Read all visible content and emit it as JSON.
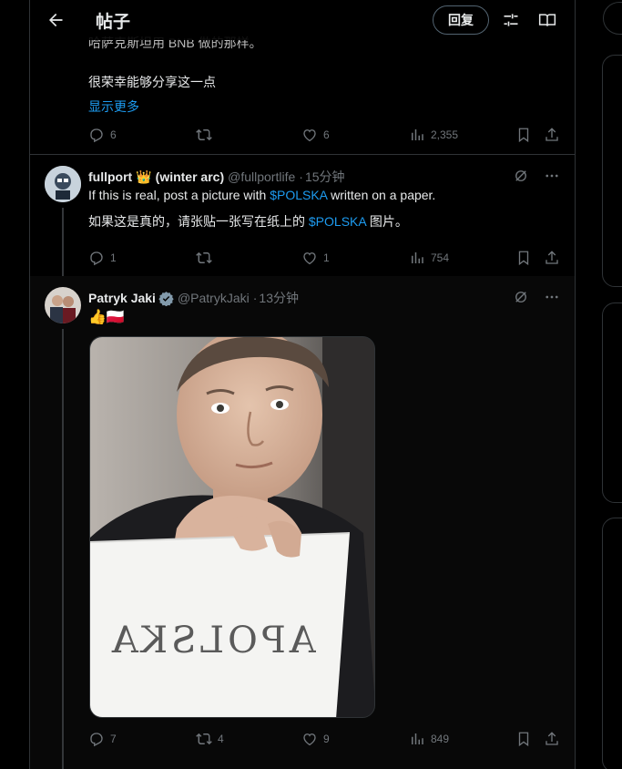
{
  "header": {
    "title": "帖子",
    "reply_label": "回复"
  },
  "prev_tweet": {
    "text_partial": "哈萨克斯坦用 BNB 做的那样。",
    "text_line2": "很荣幸能够分享这一点",
    "show_more": "显示更多",
    "replies": "6",
    "likes": "6",
    "views": "2,355"
  },
  "tweet1": {
    "name": "fullport",
    "name_suffix": "(winter arc)",
    "handle": "@fullportlife",
    "time": "15分钟",
    "text_before": "If this is real, post a picture with ",
    "cashtag": "$POLSKA",
    "text_after": " written on a paper.",
    "translation_before": "如果这是真的，请张贴一张写在纸上的 ",
    "translation_cashtag": "$POLSKA",
    "translation_after": " 图片。",
    "replies": "1",
    "likes": "1",
    "views": "754"
  },
  "tweet2": {
    "name": "Patryk Jaki",
    "handle": "@PatrykJaki",
    "time": "13分钟",
    "emoji": "👍🇵🇱",
    "paper_text": "APOLSKA",
    "replies": "7",
    "retweets": "4",
    "likes": "9",
    "views": "849"
  },
  "colors": {
    "accent": "#1d9bf0",
    "muted": "#71767b",
    "border": "#2f3336",
    "verified": "#829aab"
  }
}
